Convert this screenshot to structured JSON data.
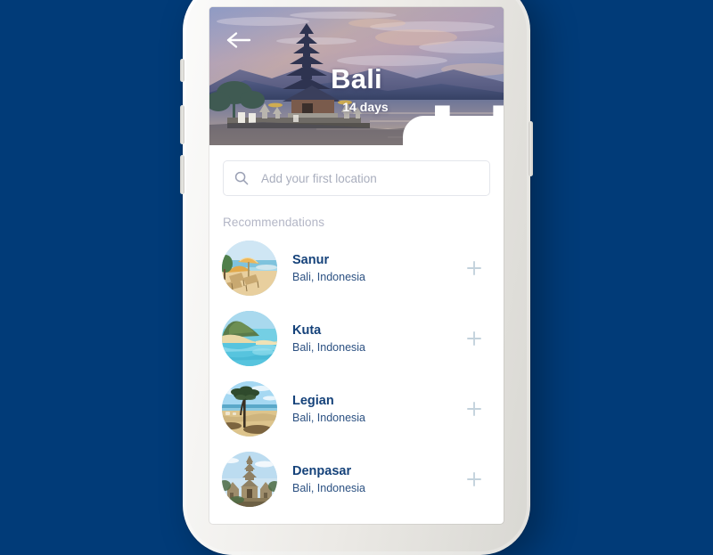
{
  "theme": {
    "background": "#013B78",
    "title_color": "#15427a",
    "subtitle_color": "#2c5182",
    "section_label_color": "#b3b6c6",
    "add_icon_color": "#c3d2dc",
    "placeholder_color": "#a9aebd"
  },
  "hero": {
    "back_icon": "arrow-left-icon",
    "title": "Bali",
    "duration_icon": "calendar-icon",
    "duration": "14 days"
  },
  "search": {
    "icon": "search-icon",
    "value": "",
    "placeholder": "Add your first location"
  },
  "recommendations": {
    "section_label": "Recommendations",
    "add_icon": "plus-icon",
    "items": [
      {
        "name": "Sanur",
        "place": "Bali, Indonesia",
        "thumb": "beach-umbrella-loungers"
      },
      {
        "name": "Kuta",
        "place": "Bali, Indonesia",
        "thumb": "headland-bay-beach"
      },
      {
        "name": "Legian",
        "place": "Bali, Indonesia",
        "thumb": "beach-tree-sand"
      },
      {
        "name": "Denpasar",
        "place": "Bali, Indonesia",
        "thumb": "stone-temple"
      }
    ]
  }
}
